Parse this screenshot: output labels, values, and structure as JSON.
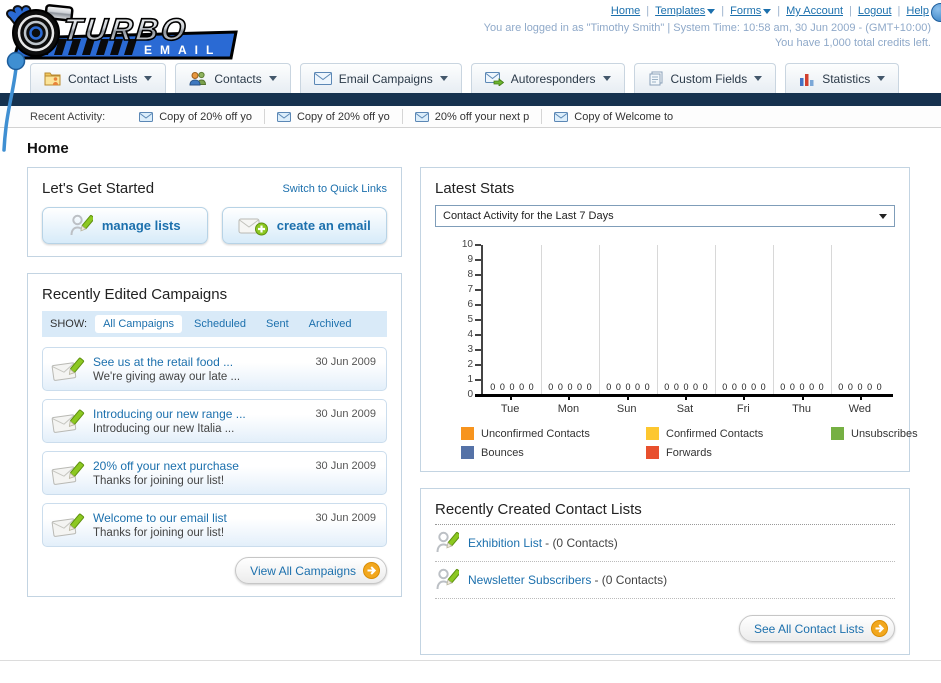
{
  "header": {
    "logo": {
      "title": "TURBO",
      "subtitle": "EMAIL"
    },
    "nav_links": [
      {
        "label": "Home",
        "dropdown": false
      },
      {
        "label": "Templates",
        "dropdown": true
      },
      {
        "label": "Forms",
        "dropdown": true
      },
      {
        "label": "My Account",
        "dropdown": false
      },
      {
        "label": "Logout",
        "dropdown": false
      },
      {
        "label": "Help",
        "dropdown": false
      }
    ],
    "login_line": "You are logged in as \"Timothy Smith\" | System Time: 10:58 am, 30 Jun 2009 - (GMT+10:00)",
    "credits_line": "You have 1,000 total credits left."
  },
  "tabs": [
    {
      "label": "Contact Lists",
      "icon": "contact-lists-folder-icon"
    },
    {
      "label": "Contacts",
      "icon": "contacts-people-icon"
    },
    {
      "label": "Email Campaigns",
      "icon": "email-campaigns-envelope-icon"
    },
    {
      "label": "Autoresponders",
      "icon": "autoresponders-envelope-icon"
    },
    {
      "label": "Custom Fields",
      "icon": "custom-fields-pages-icon"
    },
    {
      "label": "Statistics",
      "icon": "statistics-chart-icon"
    }
  ],
  "recent_activity": {
    "label": "Recent Activity:",
    "items": [
      "Copy of 20% off yo",
      "Copy of 20% off yo",
      "20% off your next p",
      "Copy of Welcome to"
    ]
  },
  "page_title": "Home",
  "get_started": {
    "title": "Let's Get Started",
    "switch_link": "Switch to Quick Links",
    "buttons": [
      {
        "label": "manage lists",
        "icon": "manage-lists-icon"
      },
      {
        "label": "create an email",
        "icon": "create-email-icon"
      }
    ]
  },
  "campaigns": {
    "title": "Recently Edited Campaigns",
    "show_label": "SHOW:",
    "filters": [
      "All Campaigns",
      "Scheduled",
      "Sent",
      "Archived"
    ],
    "active_filter": "All Campaigns",
    "view_all_label": "View All Campaigns",
    "items": [
      {
        "title": "See us at the retail food ...",
        "subtitle": "We're giving away our late ...",
        "date": "30 Jun 2009"
      },
      {
        "title": "Introducing our new range ...",
        "subtitle": "Introducing our new Italia ...",
        "date": "30 Jun 2009"
      },
      {
        "title": "20% off your next purchase",
        "subtitle": "Thanks for joining our list!",
        "date": "30 Jun 2009"
      },
      {
        "title": "Welcome to our email list",
        "subtitle": "Thanks for joining our list!",
        "date": "30 Jun 2009"
      }
    ]
  },
  "stats": {
    "title": "Latest Stats",
    "dropdown_value": "Contact Activity for the Last 7 Days"
  },
  "chart_data": {
    "type": "bar",
    "title": "Contact Activity for the Last 7 Days",
    "categories": [
      "Tue",
      "Mon",
      "Sun",
      "Sat",
      "Fri",
      "Thu",
      "Wed"
    ],
    "series": [
      {
        "name": "Unconfirmed Contacts",
        "color": "#f7941e",
        "values": [
          0,
          0,
          0,
          0,
          0,
          0,
          0
        ]
      },
      {
        "name": "Confirmed Contacts",
        "color": "#fdc72f",
        "values": [
          0,
          0,
          0,
          0,
          0,
          0,
          0
        ]
      },
      {
        "name": "Unsubscribes",
        "color": "#76b043",
        "values": [
          0,
          0,
          0,
          0,
          0,
          0,
          0
        ]
      },
      {
        "name": "Bounces",
        "color": "#5572a7",
        "values": [
          0,
          0,
          0,
          0,
          0,
          0,
          0
        ]
      },
      {
        "name": "Forwards",
        "color": "#e8502e",
        "values": [
          0,
          0,
          0,
          0,
          0,
          0,
          0
        ]
      }
    ],
    "xlabel": "",
    "ylabel": "",
    "ylim": [
      0,
      10
    ],
    "yticks": [
      0,
      1,
      2,
      3,
      4,
      5,
      6,
      7,
      8,
      9,
      10
    ],
    "grid": true,
    "legend_position": "bottom",
    "value_labels_shown": true
  },
  "contact_lists": {
    "title": "Recently Created Contact Lists",
    "see_all_label": "See All Contact Lists",
    "items": [
      {
        "name": "Exhibition List",
        "detail": "- (0 Contacts)"
      },
      {
        "name": "Newsletter Subscribers",
        "detail": "- (0 Contacts)"
      }
    ]
  },
  "colors": {
    "link_blue": "#1c70ad",
    "navy_bar": "#16324f",
    "panel_border": "#c3d4e2",
    "show_bar_bg": "#d9eaf8",
    "button_arrow_orange": "#f2a71d",
    "balloon_blue": "#3f8fd2"
  }
}
